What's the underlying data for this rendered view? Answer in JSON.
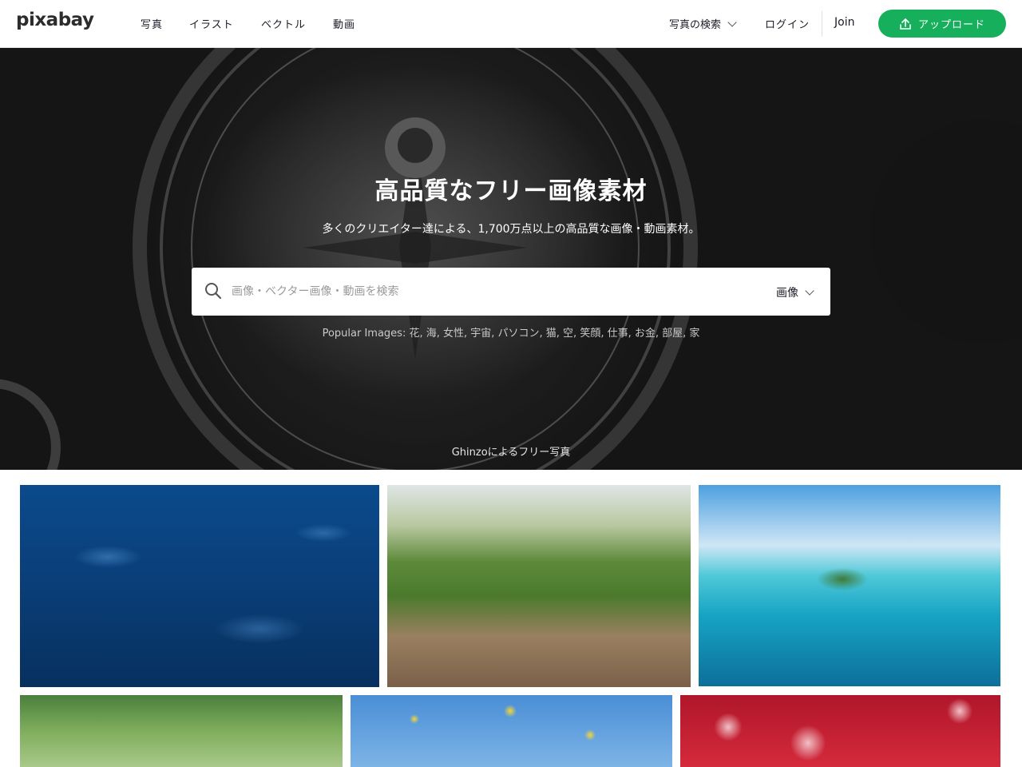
{
  "header": {
    "logo": "pixabay",
    "nav": [
      "写真",
      "イラスト",
      "ベクトル",
      "動画"
    ],
    "search_type_label": "写真の検索",
    "login": "ログイン",
    "join": "Join",
    "upload": "アップロード",
    "accent_color": "#16b05c"
  },
  "hero": {
    "title": "高品質なフリー画像素材",
    "subtitle": "多くのクリエイター達による、1,700万点以上の高品質な画像・動画素材。",
    "search_placeholder": "画像・ベクター画像・動画を検索",
    "search_category": "画像",
    "popular": "Popular Images: 花, 海, 女性, 宇宙, パソコン, 猫, 空, 笑顔, 仕事, お金, 部屋, 家",
    "credit": "Ghinzoによるフリー写真"
  },
  "icons": {
    "search": "search-icon",
    "upload": "upload-icon",
    "chevron": "chevron-down-icon"
  }
}
